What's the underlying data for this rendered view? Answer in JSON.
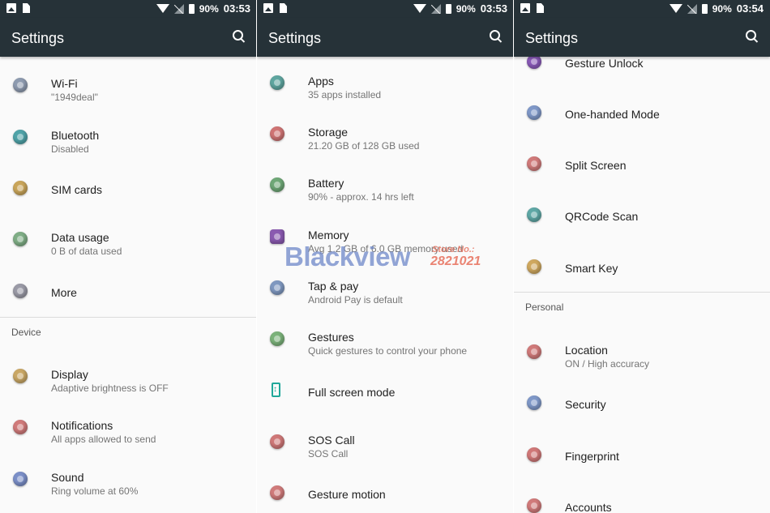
{
  "panels": [
    {
      "status": {
        "battery": "90%",
        "time": "03:53"
      },
      "title": "Settings",
      "wifi": {
        "title": "Wi-Fi",
        "subtitle": "\"1949deal\""
      },
      "bluetooth": {
        "title": "Bluetooth",
        "subtitle": "Disabled"
      },
      "sim": {
        "title": "SIM cards"
      },
      "data_usage": {
        "title": "Data usage",
        "subtitle": "0 B of data used"
      },
      "more": {
        "title": "More"
      },
      "device_header": "Device",
      "display": {
        "title": "Display",
        "subtitle": "Adaptive brightness is OFF"
      },
      "notifications": {
        "title": "Notifications",
        "subtitle": "All apps allowed to send"
      },
      "sound": {
        "title": "Sound",
        "subtitle": "Ring volume at 60%"
      }
    },
    {
      "status": {
        "battery": "90%",
        "time": "03:53"
      },
      "title": "Settings",
      "apps": {
        "title": "Apps",
        "subtitle": "35 apps installed"
      },
      "storage": {
        "title": "Storage",
        "subtitle": "21.20 GB of 128 GB used"
      },
      "battery": {
        "title": "Battery",
        "subtitle": "90% - approx. 14 hrs left"
      },
      "memory": {
        "title": "Memory",
        "subtitle": "Avg 1.2 GB of 6.0 GB memory used"
      },
      "tap_pay": {
        "title": "Tap & pay",
        "subtitle": "Android Pay is default"
      },
      "gestures": {
        "title": "Gestures",
        "subtitle": "Quick gestures to control your phone"
      },
      "full_screen": {
        "title": "Full screen mode"
      },
      "sos": {
        "title": "SOS Call",
        "subtitle": "SOS Call"
      },
      "gesture_motion": {
        "title": "Gesture motion"
      }
    },
    {
      "status": {
        "battery": "90%",
        "time": "03:54"
      },
      "title": "Settings",
      "gesture_unlock": {
        "title": "Gesture Unlock"
      },
      "one_handed": {
        "title": "One-handed Mode"
      },
      "split_screen": {
        "title": "Split Screen"
      },
      "qrcode": {
        "title": "QRCode Scan"
      },
      "smart_key": {
        "title": "Smart Key"
      },
      "personal_header": "Personal",
      "location": {
        "title": "Location",
        "subtitle": "ON / High accuracy"
      },
      "security": {
        "title": "Security"
      },
      "fingerprint": {
        "title": "Fingerprint"
      },
      "accounts": {
        "title": "Accounts"
      }
    }
  ],
  "watermark": {
    "brand": "Blackview",
    "store_label": "Store No.:",
    "store_number": "2821021"
  },
  "colors": {
    "appbar": "#263238",
    "background": "#fafafa",
    "accent": "#20a89a"
  }
}
